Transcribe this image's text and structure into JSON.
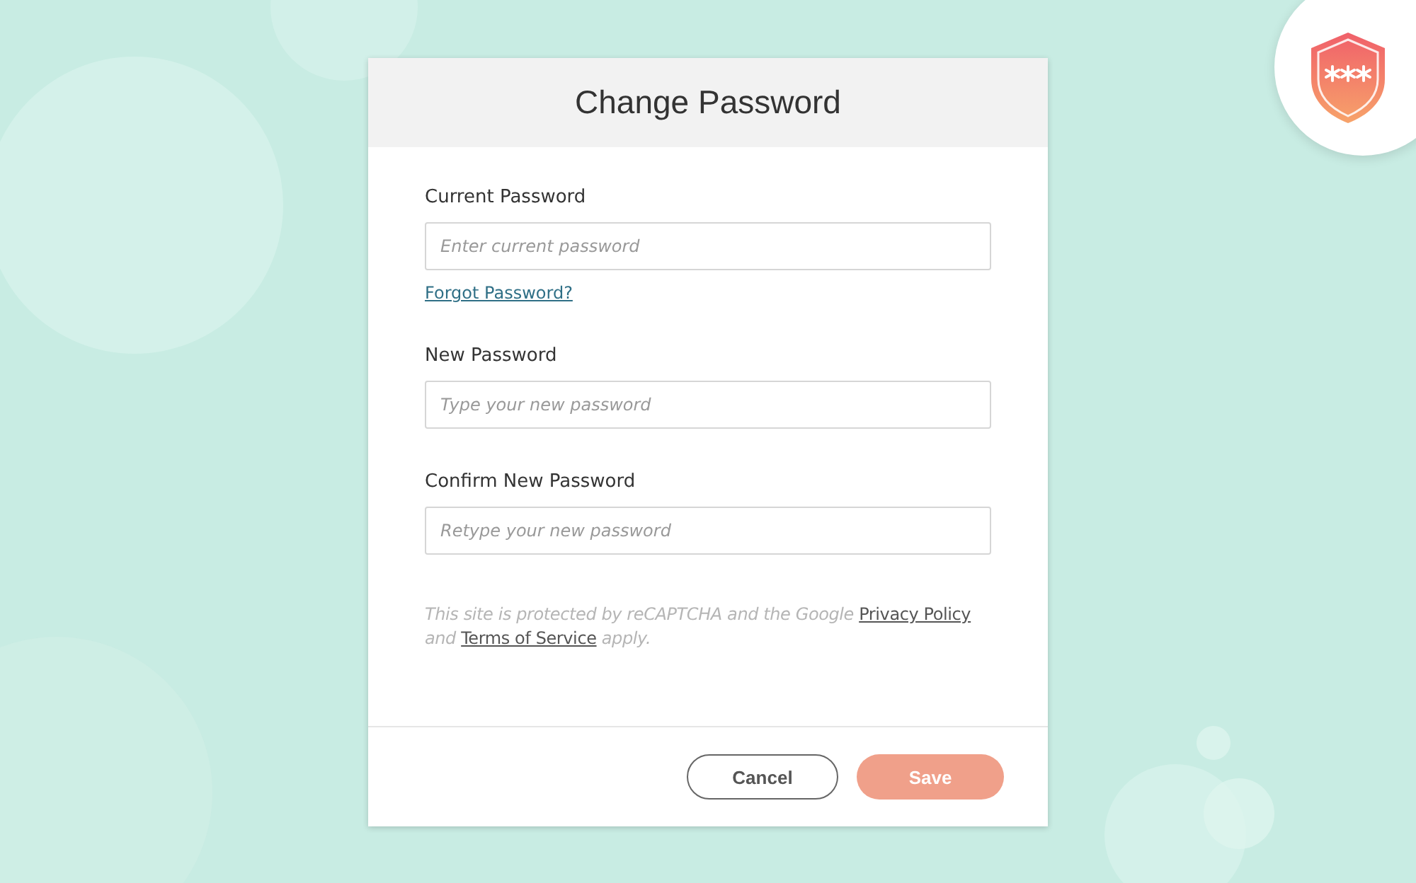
{
  "dialog": {
    "title": "Change Password"
  },
  "fields": [
    {
      "label": "Current Password",
      "placeholder": "Enter current password",
      "link": "Forgot Password?"
    },
    {
      "label": "New Password",
      "placeholder": "Type your new password"
    },
    {
      "label": "Confirm New Password",
      "placeholder": "Retype your new password"
    }
  ],
  "notice": [
    {
      "kind": "text",
      "text": "This site is protected by reCAPTCHA and the Google "
    },
    {
      "kind": "link",
      "text": "Privacy Policy"
    },
    {
      "kind": "text",
      "text": " and "
    },
    {
      "kind": "link",
      "text": "Terms of Service"
    },
    {
      "kind": "text",
      "text": " apply."
    }
  ],
  "buttons": [
    {
      "kind": "secondary",
      "label": "Cancel"
    },
    {
      "kind": "primary",
      "label": "Save",
      "disabled": true
    }
  ]
}
